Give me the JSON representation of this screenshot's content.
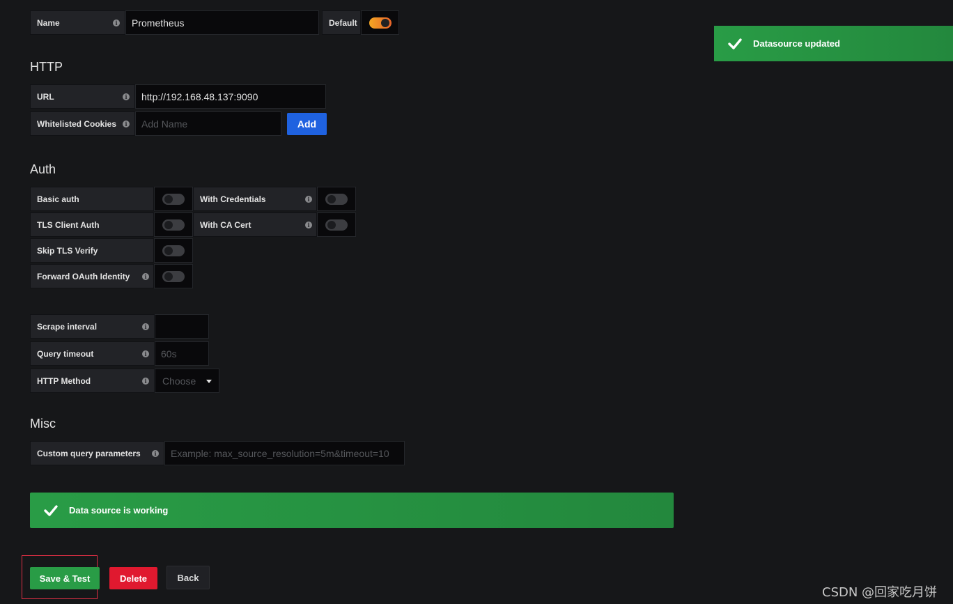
{
  "name_row": {
    "label": "Name",
    "value": "Prometheus",
    "default_label": "Default",
    "default_on": true
  },
  "http": {
    "title": "HTTP",
    "url_label": "URL",
    "url_value": "http://192.168.48.137:9090",
    "cookies_label": "Whitelisted Cookies",
    "cookies_placeholder": "Add Name",
    "add_label": "Add"
  },
  "auth": {
    "title": "Auth",
    "basic_auth": "Basic auth",
    "with_credentials": "With Credentials",
    "tls_client_auth": "TLS Client Auth",
    "with_ca_cert": "With CA Cert",
    "skip_tls_verify": "Skip TLS Verify",
    "forward_oauth": "Forward OAuth Identity"
  },
  "prom": {
    "scrape_label": "Scrape interval",
    "scrape_value": "",
    "timeout_label": "Query timeout",
    "timeout_placeholder": "60s",
    "method_label": "HTTP Method",
    "method_value": "Choose"
  },
  "misc": {
    "title": "Misc",
    "custom_label": "Custom query parameters",
    "custom_placeholder": "Example: max_source_resolution=5m&timeout=10"
  },
  "alerts": {
    "working": "Data source is working",
    "toast": "Datasource updated"
  },
  "buttons": {
    "save": "Save & Test",
    "delete": "Delete",
    "back": "Back"
  },
  "watermark": "CSDN @回家吃月饼",
  "colors": {
    "success": "#299c46",
    "primary": "#1f62e0",
    "danger": "#d44a3a",
    "highlight_box": "#e02f44"
  }
}
